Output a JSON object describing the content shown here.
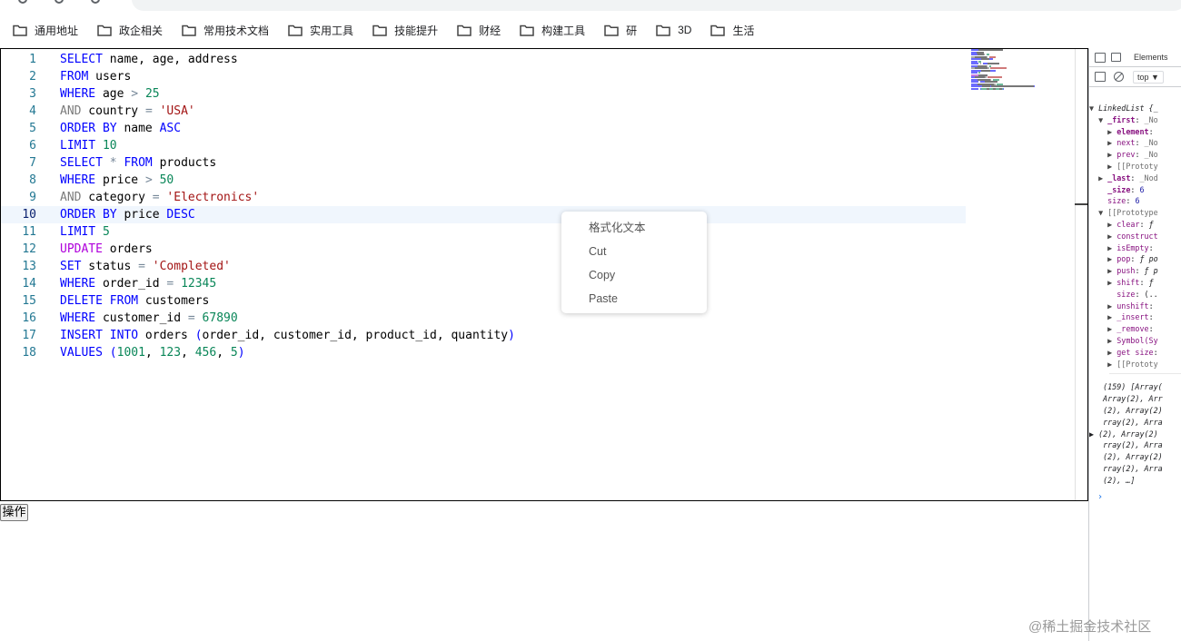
{
  "bookmarks": [
    {
      "label": "通用地址",
      "icon": "folder-icon"
    },
    {
      "label": "政企相关",
      "icon": "folder-icon"
    },
    {
      "label": "常用技术文档",
      "icon": "folder-icon"
    },
    {
      "label": "实用工具",
      "icon": "folder-icon"
    },
    {
      "label": "技能提升",
      "icon": "folder-icon"
    },
    {
      "label": "财经",
      "icon": "folder-icon"
    },
    {
      "label": "构建工具",
      "icon": "folder-icon"
    },
    {
      "label": "研",
      "icon": "folder-icon"
    },
    {
      "label": "3D",
      "icon": "folder-icon"
    },
    {
      "label": "生活",
      "icon": "folder-icon"
    }
  ],
  "editor": {
    "current_line": 10,
    "lines": [
      {
        "n": "1",
        "tokens": [
          [
            "kw",
            "SELECT"
          ],
          [
            "",
            " name, age, address"
          ]
        ]
      },
      {
        "n": "2",
        "tokens": [
          [
            "kw",
            "FROM"
          ],
          [
            "",
            " users"
          ]
        ]
      },
      {
        "n": "3",
        "tokens": [
          [
            "kw",
            "WHERE"
          ],
          [
            "",
            " age "
          ],
          [
            "op",
            ">"
          ],
          [
            "",
            " "
          ],
          [
            "num",
            "25"
          ]
        ]
      },
      {
        "n": "4",
        "tokens": [
          [
            "gray",
            "AND"
          ],
          [
            "",
            " country "
          ],
          [
            "op",
            "="
          ],
          [
            "",
            " "
          ],
          [
            "str",
            "'USA'"
          ]
        ]
      },
      {
        "n": "5",
        "tokens": [
          [
            "kw",
            "ORDER BY"
          ],
          [
            "",
            " name "
          ],
          [
            "kw",
            "ASC"
          ]
        ]
      },
      {
        "n": "6",
        "tokens": [
          [
            "kw",
            "LIMIT"
          ],
          [
            "",
            " "
          ],
          [
            "num",
            "10"
          ]
        ]
      },
      {
        "n": "7",
        "tokens": [
          [
            "kw",
            "SELECT"
          ],
          [
            "",
            " "
          ],
          [
            "op",
            "*"
          ],
          [
            "",
            " "
          ],
          [
            "kw",
            "FROM"
          ],
          [
            "",
            " products"
          ]
        ]
      },
      {
        "n": "8",
        "tokens": [
          [
            "kw",
            "WHERE"
          ],
          [
            "",
            " price "
          ],
          [
            "op",
            ">"
          ],
          [
            "",
            " "
          ],
          [
            "num",
            "50"
          ]
        ]
      },
      {
        "n": "9",
        "tokens": [
          [
            "gray",
            "AND"
          ],
          [
            "",
            " category "
          ],
          [
            "op",
            "="
          ],
          [
            "",
            " "
          ],
          [
            "str",
            "'Electronics'"
          ]
        ]
      },
      {
        "n": "10",
        "tokens": [
          [
            "kw",
            "ORDER BY"
          ],
          [
            "",
            " price "
          ],
          [
            "kw",
            "DESC"
          ]
        ]
      },
      {
        "n": "11",
        "tokens": [
          [
            "kw",
            "LIMIT"
          ],
          [
            "",
            " "
          ],
          [
            "num",
            "5"
          ]
        ]
      },
      {
        "n": "12",
        "tokens": [
          [
            "kw2",
            "UPDATE"
          ],
          [
            "",
            " orders"
          ]
        ]
      },
      {
        "n": "13",
        "tokens": [
          [
            "kw",
            "SET"
          ],
          [
            "",
            " status "
          ],
          [
            "op",
            "="
          ],
          [
            "",
            " "
          ],
          [
            "str",
            "'Completed'"
          ]
        ]
      },
      {
        "n": "14",
        "tokens": [
          [
            "kw",
            "WHERE"
          ],
          [
            "",
            " order_id "
          ],
          [
            "op",
            "="
          ],
          [
            "",
            " "
          ],
          [
            "num",
            "12345"
          ]
        ]
      },
      {
        "n": "15",
        "tokens": [
          [
            "kw",
            "DELETE"
          ],
          [
            "",
            " "
          ],
          [
            "kw",
            "FROM"
          ],
          [
            "",
            " customers"
          ]
        ]
      },
      {
        "n": "16",
        "tokens": [
          [
            "kw",
            "WHERE"
          ],
          [
            "",
            " customer_id "
          ],
          [
            "op",
            "="
          ],
          [
            "",
            " "
          ],
          [
            "num",
            "67890"
          ]
        ]
      },
      {
        "n": "17",
        "tokens": [
          [
            "kw",
            "INSERT INTO"
          ],
          [
            "",
            " orders "
          ],
          [
            "kw",
            "("
          ],
          [
            "",
            "order_id, customer_id, product_id, quantity"
          ],
          [
            "kw",
            ")"
          ]
        ]
      },
      {
        "n": "18",
        "tokens": [
          [
            "kw",
            "VALUES"
          ],
          [
            "",
            " "
          ],
          [
            "kw",
            "("
          ],
          [
            "num",
            "1001"
          ],
          [
            "",
            ", "
          ],
          [
            "num",
            "123"
          ],
          [
            "",
            ", "
          ],
          [
            "num",
            "456"
          ],
          [
            "",
            ", "
          ],
          [
            "num",
            "5"
          ],
          [
            "kw",
            ")"
          ]
        ]
      }
    ]
  },
  "context_menu": {
    "items": [
      "格式化文本",
      "Cut",
      "Copy",
      "Paste"
    ]
  },
  "operate_button": {
    "label": "操作"
  },
  "devtools": {
    "tab_label": "Elements",
    "context_label": "top ▼",
    "console_lines": [
      [
        [
          "tri",
          "▼ "
        ],
        [
          "it",
          "LinkedList {_"
        ]
      ],
      [
        [
          "tri",
          "  ▼ "
        ],
        [
          "key",
          "_first"
        ],
        [
          "",
          ": "
        ],
        [
          "dim",
          "_No"
        ]
      ],
      [
        [
          "tri",
          "    ▶ "
        ],
        [
          "key",
          "element"
        ],
        [
          "",
          ":"
        ]
      ],
      [
        [
          "tri",
          "    ▶ "
        ],
        [
          "key-dim",
          "next"
        ],
        [
          "",
          ": "
        ],
        [
          "dim",
          "_No"
        ]
      ],
      [
        [
          "tri",
          "    ▶ "
        ],
        [
          "key-dim",
          "prev"
        ],
        [
          "",
          ": "
        ],
        [
          "dim",
          "_No"
        ]
      ],
      [
        [
          "tri",
          "    ▶ "
        ],
        [
          "dim",
          "[[Prototy"
        ]
      ],
      [
        [
          "tri",
          "  ▶ "
        ],
        [
          "key",
          "_last"
        ],
        [
          "",
          ": "
        ],
        [
          "dim",
          "_Nod"
        ]
      ],
      [
        [
          "",
          "    "
        ],
        [
          "key",
          "_size"
        ],
        [
          "",
          ": "
        ],
        [
          "val",
          "6"
        ]
      ],
      [
        [
          "",
          "    "
        ],
        [
          "key-dim",
          "size"
        ],
        [
          "",
          ": "
        ],
        [
          "val",
          "6"
        ]
      ],
      [
        [
          "tri",
          "  ▼ "
        ],
        [
          "dim",
          "[[Prototype"
        ]
      ],
      [
        [
          "tri",
          "    ▶ "
        ],
        [
          "key-dim",
          "clear"
        ],
        [
          "",
          ": "
        ],
        [
          "it",
          "ƒ"
        ]
      ],
      [
        [
          "tri",
          "    ▶ "
        ],
        [
          "key-dim",
          "construct"
        ]
      ],
      [
        [
          "tri",
          "    ▶ "
        ],
        [
          "key-dim",
          "isEmpty"
        ],
        [
          "",
          ":"
        ]
      ],
      [
        [
          "tri",
          "    ▶ "
        ],
        [
          "key-dim",
          "pop"
        ],
        [
          "",
          ": "
        ],
        [
          "it",
          "ƒ po"
        ]
      ],
      [
        [
          "tri",
          "    ▶ "
        ],
        [
          "key-dim",
          "push"
        ],
        [
          "",
          ": "
        ],
        [
          "it",
          "ƒ p"
        ]
      ],
      [
        [
          "tri",
          "    ▶ "
        ],
        [
          "key-dim",
          "shift"
        ],
        [
          "",
          ": "
        ],
        [
          "it",
          "ƒ"
        ]
      ],
      [
        [
          "",
          "      "
        ],
        [
          "key-dim",
          "size"
        ],
        [
          "",
          ": (.."
        ]
      ],
      [
        [
          "tri",
          "    ▶ "
        ],
        [
          "key-dim",
          "unshift"
        ],
        [
          "",
          ":"
        ]
      ],
      [
        [
          "tri",
          "    ▶ "
        ],
        [
          "key-dim",
          "_insert"
        ],
        [
          "",
          ":"
        ]
      ],
      [
        [
          "tri",
          "    ▶ "
        ],
        [
          "key-dim",
          "_remove"
        ],
        [
          "",
          ":"
        ]
      ],
      [
        [
          "tri",
          "    ▶ "
        ],
        [
          "key-dim",
          "Symbol(Sy"
        ]
      ],
      [
        [
          "tri",
          "    ▶ "
        ],
        [
          "key-dim",
          "get size"
        ],
        [
          "",
          ":"
        ]
      ],
      [
        [
          "tri",
          "    ▶ "
        ],
        [
          "dim",
          "[[Prototy"
        ]
      ]
    ],
    "array_lines": [
      "   (159) [Array(",
      "   Array(2), Arr",
      "   (2), Array(2)",
      "   rray(2), Arra",
      "▶ (2), Array(2)",
      "   rray(2), Arra",
      "   (2), Array(2)",
      "   rray(2), Arra",
      "   (2), …]"
    ],
    "prompt": "›"
  },
  "watermark": "@稀土掘金技术社区",
  "colors": {
    "keyword": "#0000ff",
    "number": "#098658",
    "string": "#a31515",
    "current_line_bg": "#f0f6fd"
  }
}
